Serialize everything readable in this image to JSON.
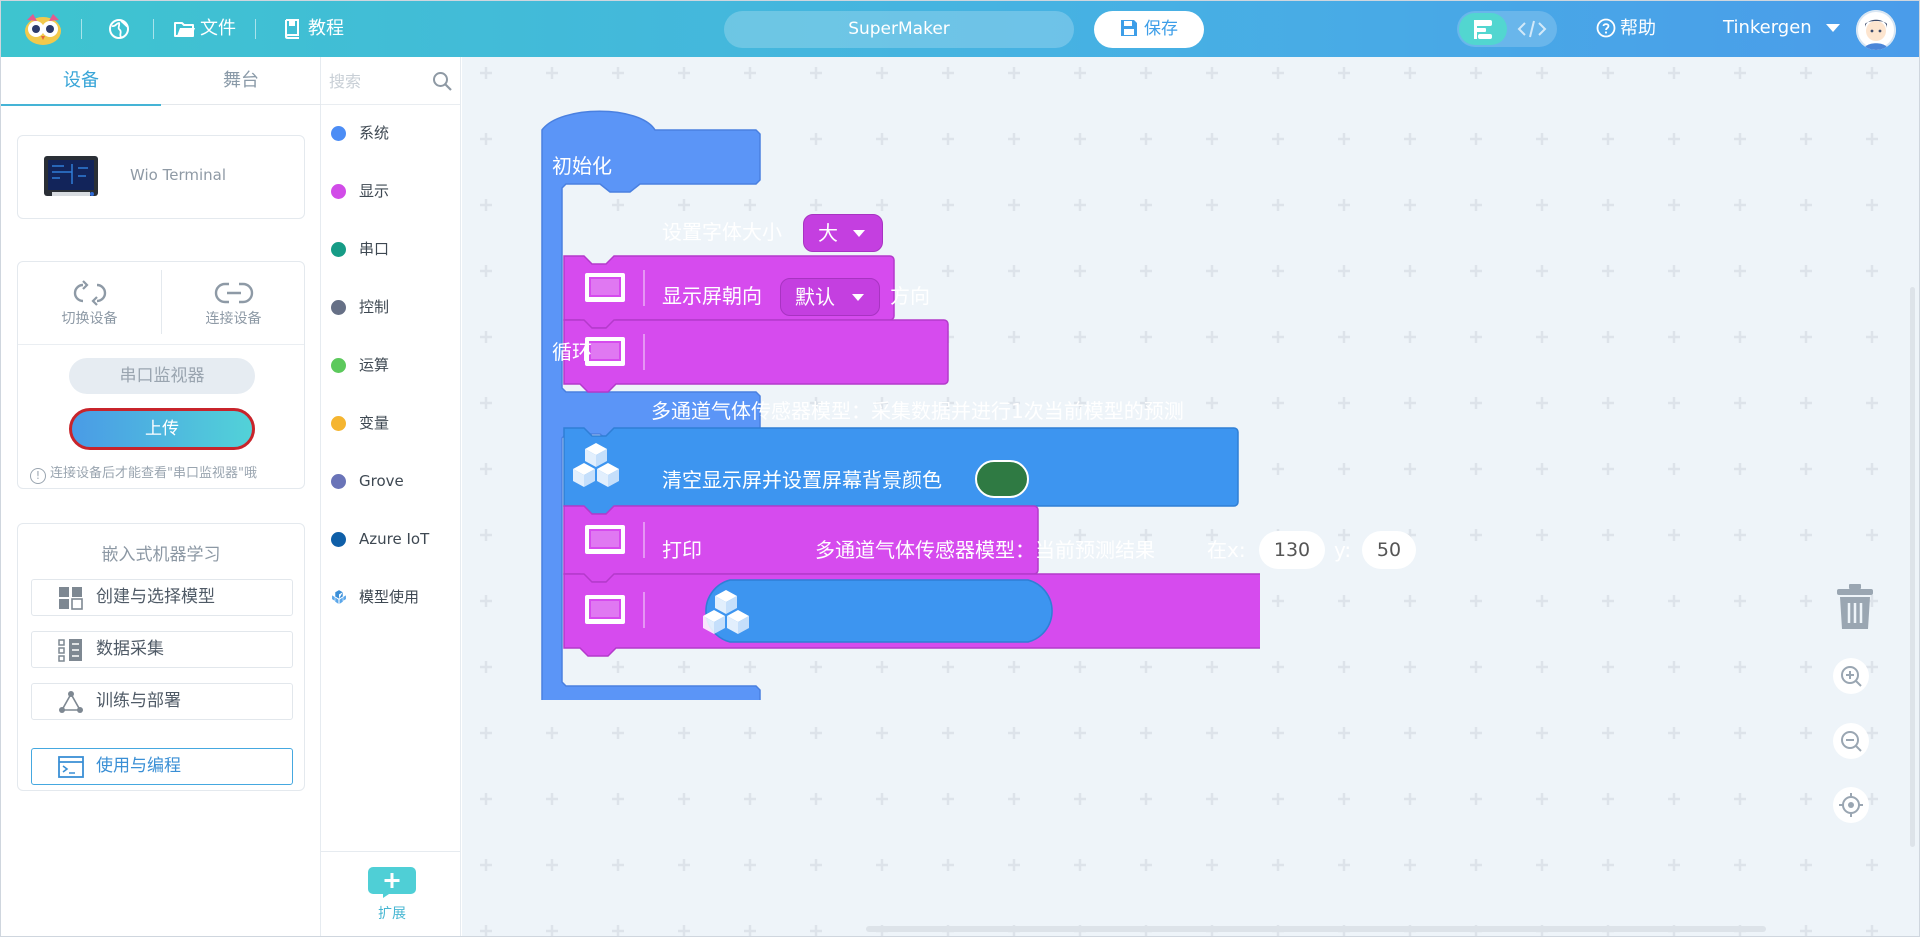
{
  "app": {
    "name": "SuperMaker"
  },
  "header": {
    "file_label": "文件",
    "tutorial_label": "教程",
    "project_name": "SuperMaker",
    "save_label": "保存",
    "help_label": "帮助",
    "user_name": "Tinkergen"
  },
  "left": {
    "tabs": [
      "设备",
      "舞台"
    ],
    "device_name": "Wio Terminal",
    "switch_device": "切换设备",
    "connect_device": "连接设备",
    "serial_monitor": "串口监视器",
    "upload": "上传",
    "tip": "连接设备后才能查看\"串口监视器\"哦",
    "ml_title": "嵌入式机器学习",
    "ml_items": [
      "创建与选择模型",
      "数据采集",
      "训练与部署",
      "使用与编程"
    ]
  },
  "categories": {
    "search_placeholder": "搜索",
    "items": [
      {
        "label": "系统",
        "color": "#4c8df5"
      },
      {
        "label": "显示",
        "color": "#d14ce8"
      },
      {
        "label": "串口",
        "color": "#169c86"
      },
      {
        "label": "控制",
        "color": "#667086"
      },
      {
        "label": "运算",
        "color": "#5cc95c"
      },
      {
        "label": "变量",
        "color": "#f5b530"
      },
      {
        "label": "Grove",
        "color": "#6a74b8"
      },
      {
        "label": "Azure IoT",
        "color": "#0f5fa8"
      },
      {
        "label": "模型使用",
        "color": "#3b8fd8"
      }
    ],
    "extension_label": "扩展"
  },
  "blocks": {
    "init_label": "初始化",
    "loop_label": "循环",
    "set_font_size": "设置字体大小",
    "font_size_value": "大",
    "screen_orientation": "显示屏朝向",
    "orientation_value": "默认",
    "orientation_suffix": "方向",
    "model_predict": "多通道气体传感器模型：采集数据并进行1次当前模型的预测",
    "clear_screen": "清空显示屏并设置屏幕背景颜色",
    "bg_color": "#2f7a43",
    "print_label": "打印",
    "model_result": "多通道气体传感器模型：当前预测结果",
    "at_x": "在x:",
    "x_value": "130",
    "y_label": "y:",
    "y_value": "50"
  },
  "colors": {
    "header_gradient_start": "#3ec4cf",
    "header_gradient_end": "#4a9cea",
    "event_block": "#5b95f7",
    "display_block": "#d64bee",
    "model_block": "#3d95f0",
    "workspace_bg": "#eef4f9"
  }
}
